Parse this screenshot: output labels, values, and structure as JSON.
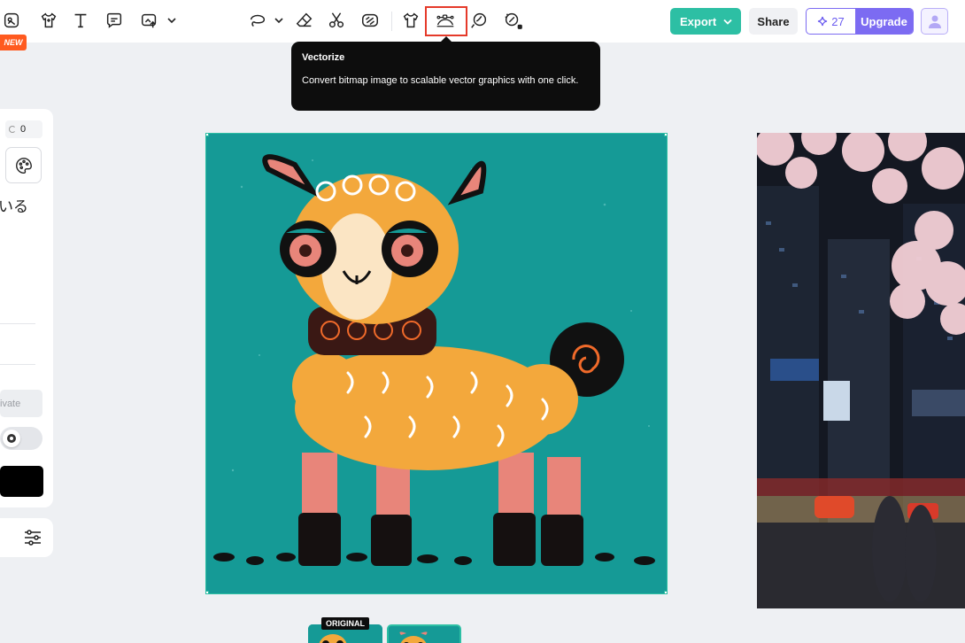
{
  "toolbar": {
    "left_icons": [
      "image-edit-icon",
      "shirt-icon",
      "text-icon",
      "comment-icon",
      "upload-icon"
    ],
    "center_icons": [
      "lasso-icon",
      "eraser-icon",
      "scissors-icon",
      "erase-bg-icon",
      "tshirt-icon",
      "vectorize-icon",
      "retouch-icon",
      "magic-brush-icon"
    ],
    "new_badge": "NEW",
    "highlighted_tool": "vectorize-icon"
  },
  "header": {
    "export_label": "Export",
    "share_label": "Share",
    "credits_count": "27",
    "upgrade_label": "Upgrade"
  },
  "tooltip": {
    "title": "Vectorize",
    "description": "Convert bitmap image to scalable vector graphics with one click."
  },
  "left_panel": {
    "number_value": "0",
    "jp_text": "いる",
    "private_label": "ivate"
  },
  "thumbnails": {
    "original_label": "ORIGINAL"
  },
  "colors": {
    "accent": "#2dbfa4",
    "upgrade": "#7c6bf2",
    "canvas_bg": "#159a96",
    "highlight": "#e53a2a"
  }
}
